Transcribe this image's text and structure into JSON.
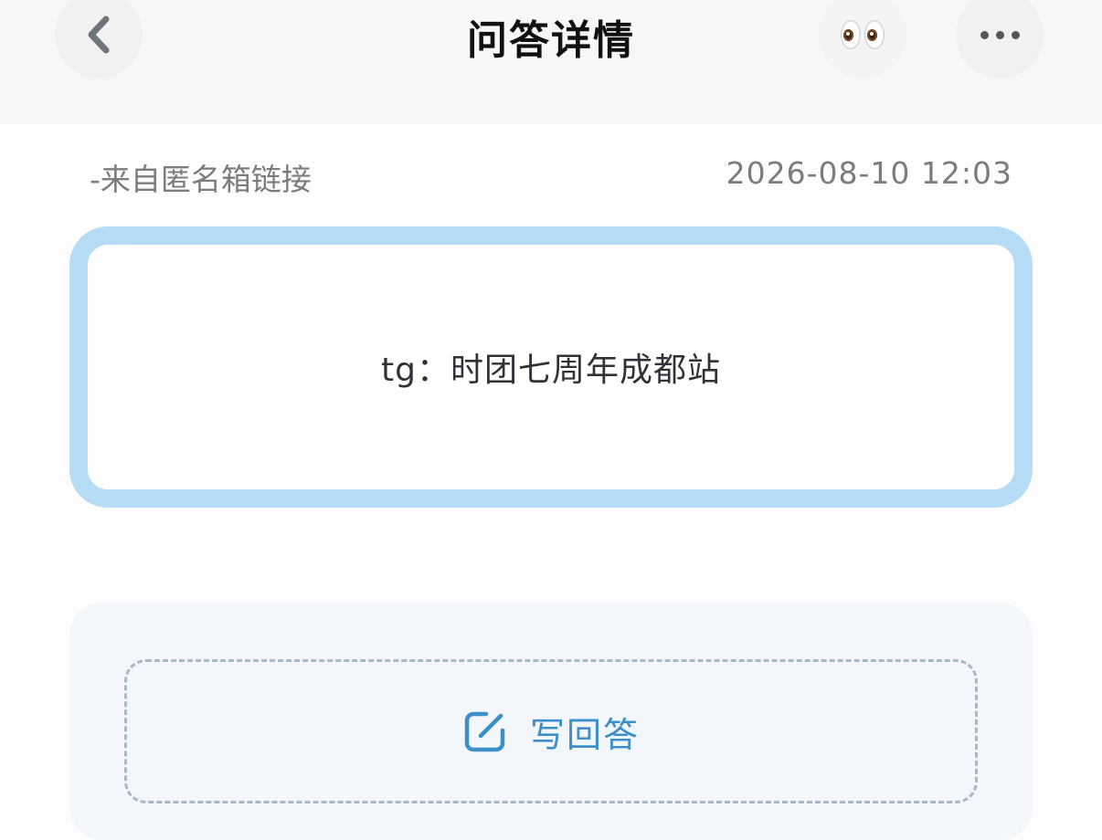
{
  "header": {
    "title": "问答详情",
    "back_icon": "chevron-left-icon",
    "eyes_icon": "eyes-emoji-icon",
    "more_icon": "more-dots-icon"
  },
  "meta": {
    "source": "-来自匿名箱链接",
    "timestamp": "2026-08-10 12:03"
  },
  "question": {
    "text": "tg：时团七周年成都站"
  },
  "answer": {
    "button_label": "写回答",
    "icon": "edit-icon"
  },
  "colors": {
    "card_border": "#b6dcf5",
    "accent": "#3d8fc9",
    "dashed_border": "#a9b8c4",
    "panel_bg": "#f3f7fb"
  }
}
